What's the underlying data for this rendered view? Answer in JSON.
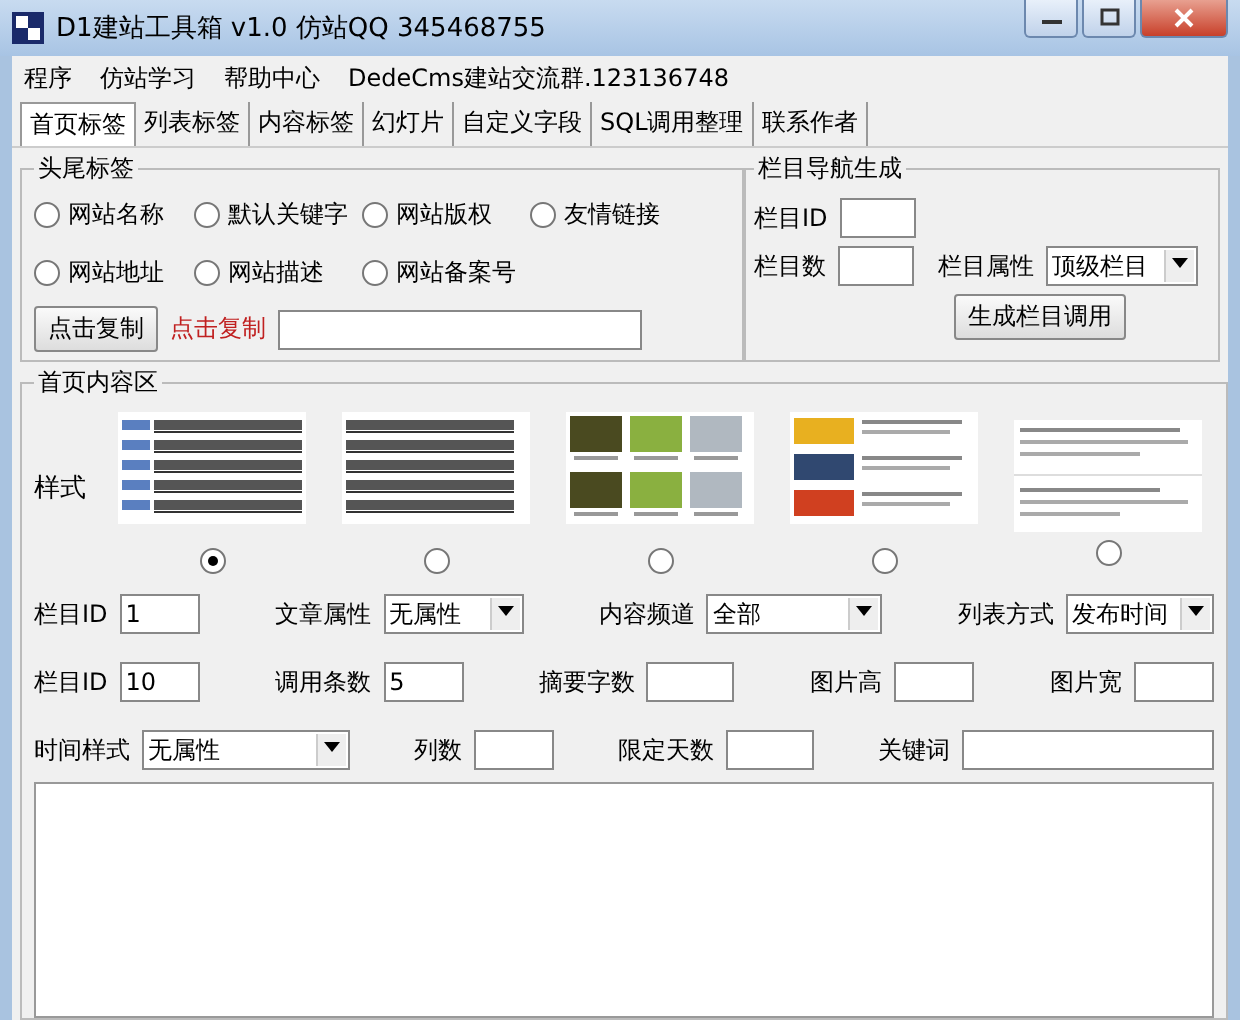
{
  "window": {
    "title": "D1建站工具箱 v1.0    仿站QQ 345468755"
  },
  "menu": [
    "程序",
    "仿站学习",
    "帮助中心",
    "DedeCms建站交流群.123136748"
  ],
  "tabs": [
    {
      "label": "首页标签",
      "selected": true
    },
    {
      "label": "列表标签",
      "selected": false
    },
    {
      "label": "内容标签",
      "selected": false
    },
    {
      "label": "幻灯片",
      "selected": false
    },
    {
      "label": "自定义字段",
      "selected": false
    },
    {
      "label": "SQL调用整理",
      "selected": false
    },
    {
      "label": "联系作者",
      "selected": false
    }
  ],
  "header_footer": {
    "title": "头尾标签",
    "options": [
      {
        "label": "网站名称",
        "selected": false
      },
      {
        "label": "默认关键字",
        "selected": false
      },
      {
        "label": "网站版权",
        "selected": false
      },
      {
        "label": "友情链接",
        "selected": false
      },
      {
        "label": "网站地址",
        "selected": false
      },
      {
        "label": "网站描述",
        "selected": false
      },
      {
        "label": "网站备案号",
        "selected": false
      }
    ],
    "copy_button": "点击复制",
    "copy_label": "点击复制"
  },
  "nav": {
    "title": "栏目导航生成",
    "id_label": "栏目ID",
    "count_label": "栏目数",
    "attr_label": "栏目属性",
    "attr_value": "顶级栏目",
    "button": "生成栏目调用"
  },
  "content": {
    "title": "首页内容区",
    "style_label": "样式",
    "styles": [
      {
        "kind": "list",
        "selected": true
      },
      {
        "kind": "plain",
        "selected": false
      },
      {
        "kind": "grid",
        "selected": false
      },
      {
        "kind": "rows",
        "selected": false
      },
      {
        "kind": "text",
        "selected": false
      }
    ],
    "row1": [
      {
        "kind": "input",
        "label": "栏目ID",
        "value": "1"
      },
      {
        "kind": "select",
        "label": "文章属性",
        "value": "无属性"
      },
      {
        "kind": "select",
        "label": "内容频道",
        "value": "全部"
      },
      {
        "kind": "select",
        "label": "列表方式",
        "value": "发布时间"
      }
    ],
    "row2": [
      {
        "kind": "input",
        "label": "栏目ID",
        "value": "10"
      },
      {
        "kind": "input",
        "label": "调用条数",
        "value": "5"
      },
      {
        "kind": "input",
        "label": "摘要字数"
      },
      {
        "kind": "input",
        "label": "图片高"
      },
      {
        "kind": "input",
        "label": "图片宽"
      }
    ],
    "row3": [
      {
        "kind": "select",
        "label": "时间样式",
        "value": "无属性"
      },
      {
        "kind": "input",
        "label": "列数"
      },
      {
        "kind": "input",
        "label": "限定天数"
      },
      {
        "kind": "input",
        "label": "关键词"
      }
    ]
  }
}
